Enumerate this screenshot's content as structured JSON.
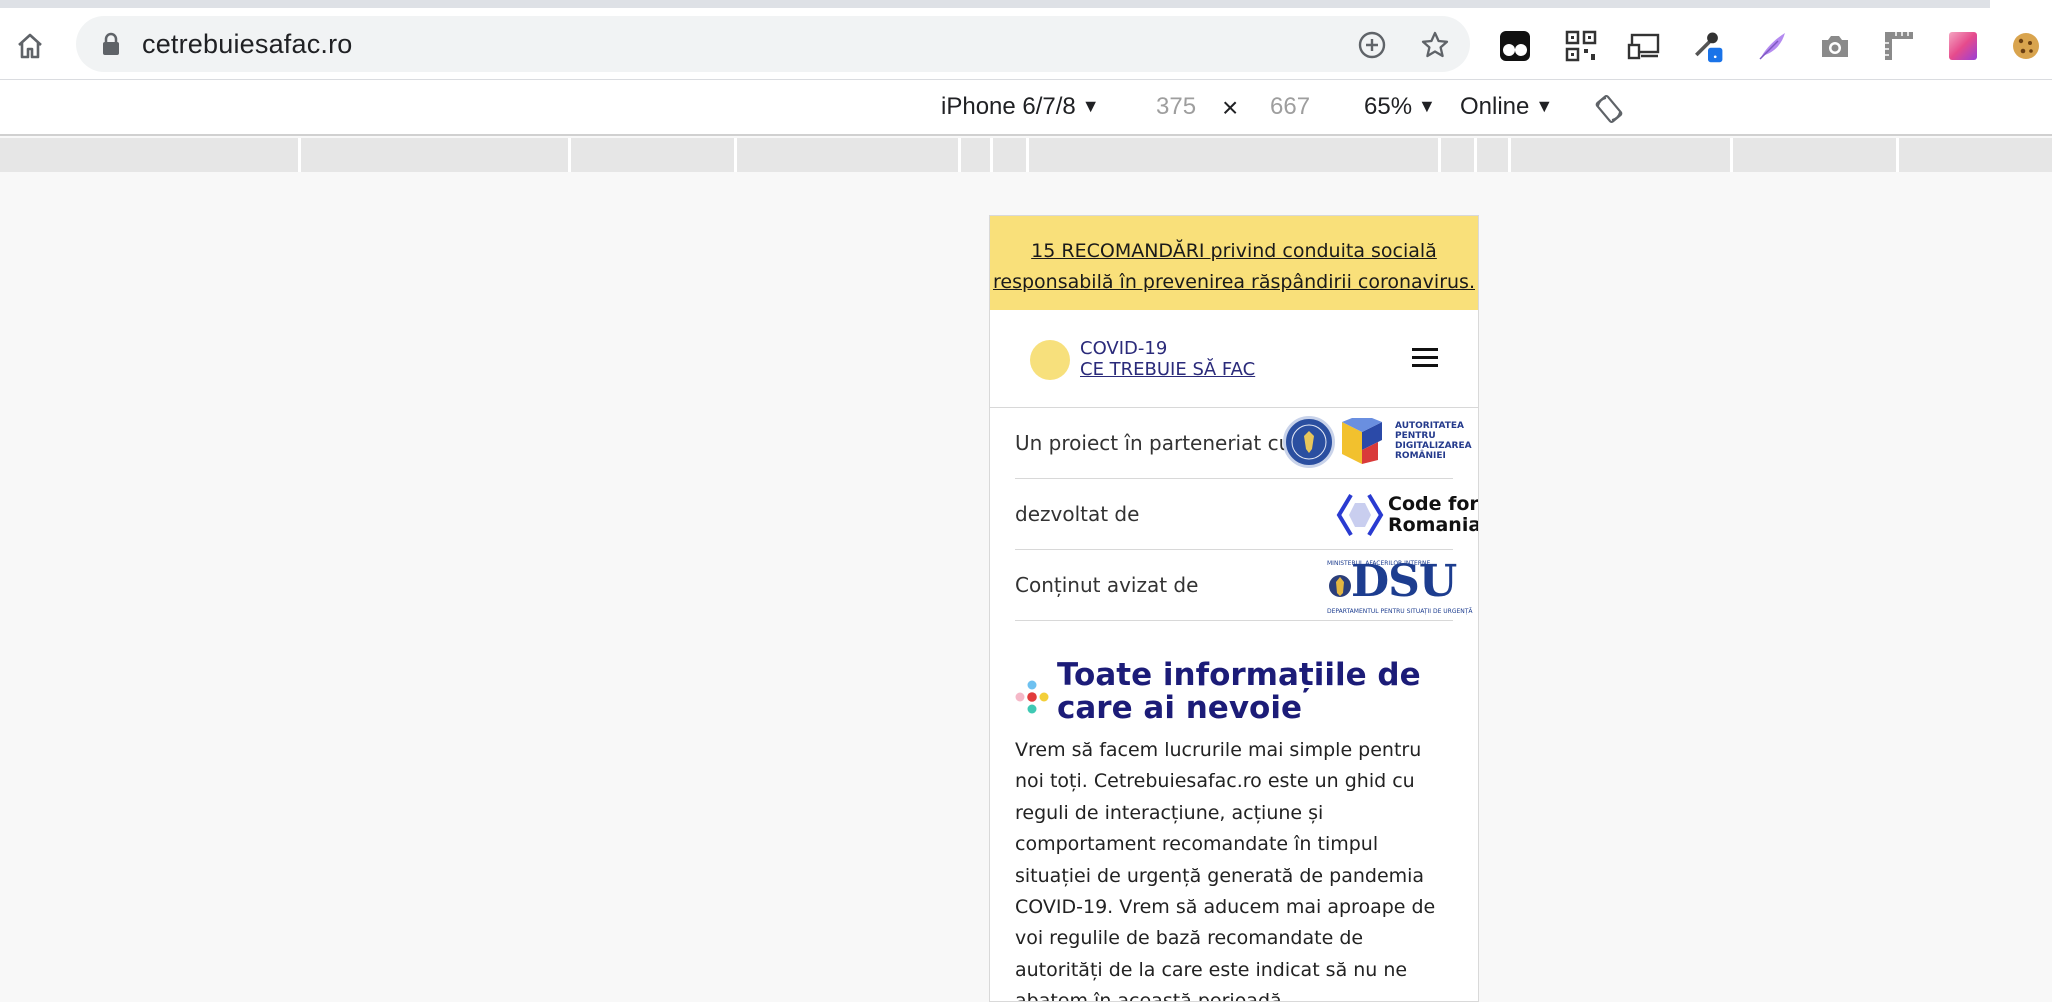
{
  "browser": {
    "url": "cetrebuiesafac.ro",
    "icons": [
      "home-icon",
      "lock-icon",
      "add-icon",
      "bookmark-star-icon"
    ],
    "extensions": [
      "tampermonkey-icon",
      "qr-code-icon",
      "cast-icon",
      "eyedropper-icon",
      "feather-icon",
      "camera-icon",
      "ruler-icon",
      "color-palette-icon",
      "cookie-icon"
    ]
  },
  "device_toolbar": {
    "device": "iPhone 6/7/8",
    "width": "375",
    "times": "×",
    "height": "667",
    "zoom": "65%",
    "network": "Online",
    "caret": "▼"
  },
  "site": {
    "banner_line1": "15 RECOMANDĂRI privind conduita socială",
    "banner_line2": "responsabilă în prevenirea răspândirii coronavirus.",
    "logo_line1": "COVID-19",
    "logo_line2": "CE TREBUIE SĂ FAC",
    "partners": {
      "label": "Un proiect în parteneriat cu",
      "gov_seal_text": "GUVERNUL ROMÂNIEI",
      "adr_lines": [
        "AUTORITATEA",
        "PENTRU",
        "DIGITALIZAREA",
        "ROMÂNIEI"
      ]
    },
    "developed": {
      "label": "dezvoltat de",
      "org_line1": "Code for",
      "org_line2": "Romania"
    },
    "endorsed": {
      "label": "Conținut avizat de",
      "dsu_top": "MINISTERUL AFACERILOR INTERNE",
      "dsu_main": "DSU",
      "dsu_bottom": "DEPARTAMENTUL PENTRU SITUAȚII DE URGENȚĂ"
    },
    "section_title": "Toate informațiile de care ai nevoie",
    "paragraph": "Vrem să facem lucrurile mai simple pentru noi toți. Cetrebuiesafac.ro este un ghid cu reguli de interacțiune, acțiune și comportament recomandate în timpul situației de urgență generată de pandemia COVID-19. Vrem să aducem mai aproape de voi regulile de bază recomandate de autorități de la care este indicat să nu ne abatem în această perioadă.",
    "colors": {
      "banner": "#f9e07a",
      "title": "#1c1c78",
      "logo_circle": "#f7e07c"
    }
  }
}
